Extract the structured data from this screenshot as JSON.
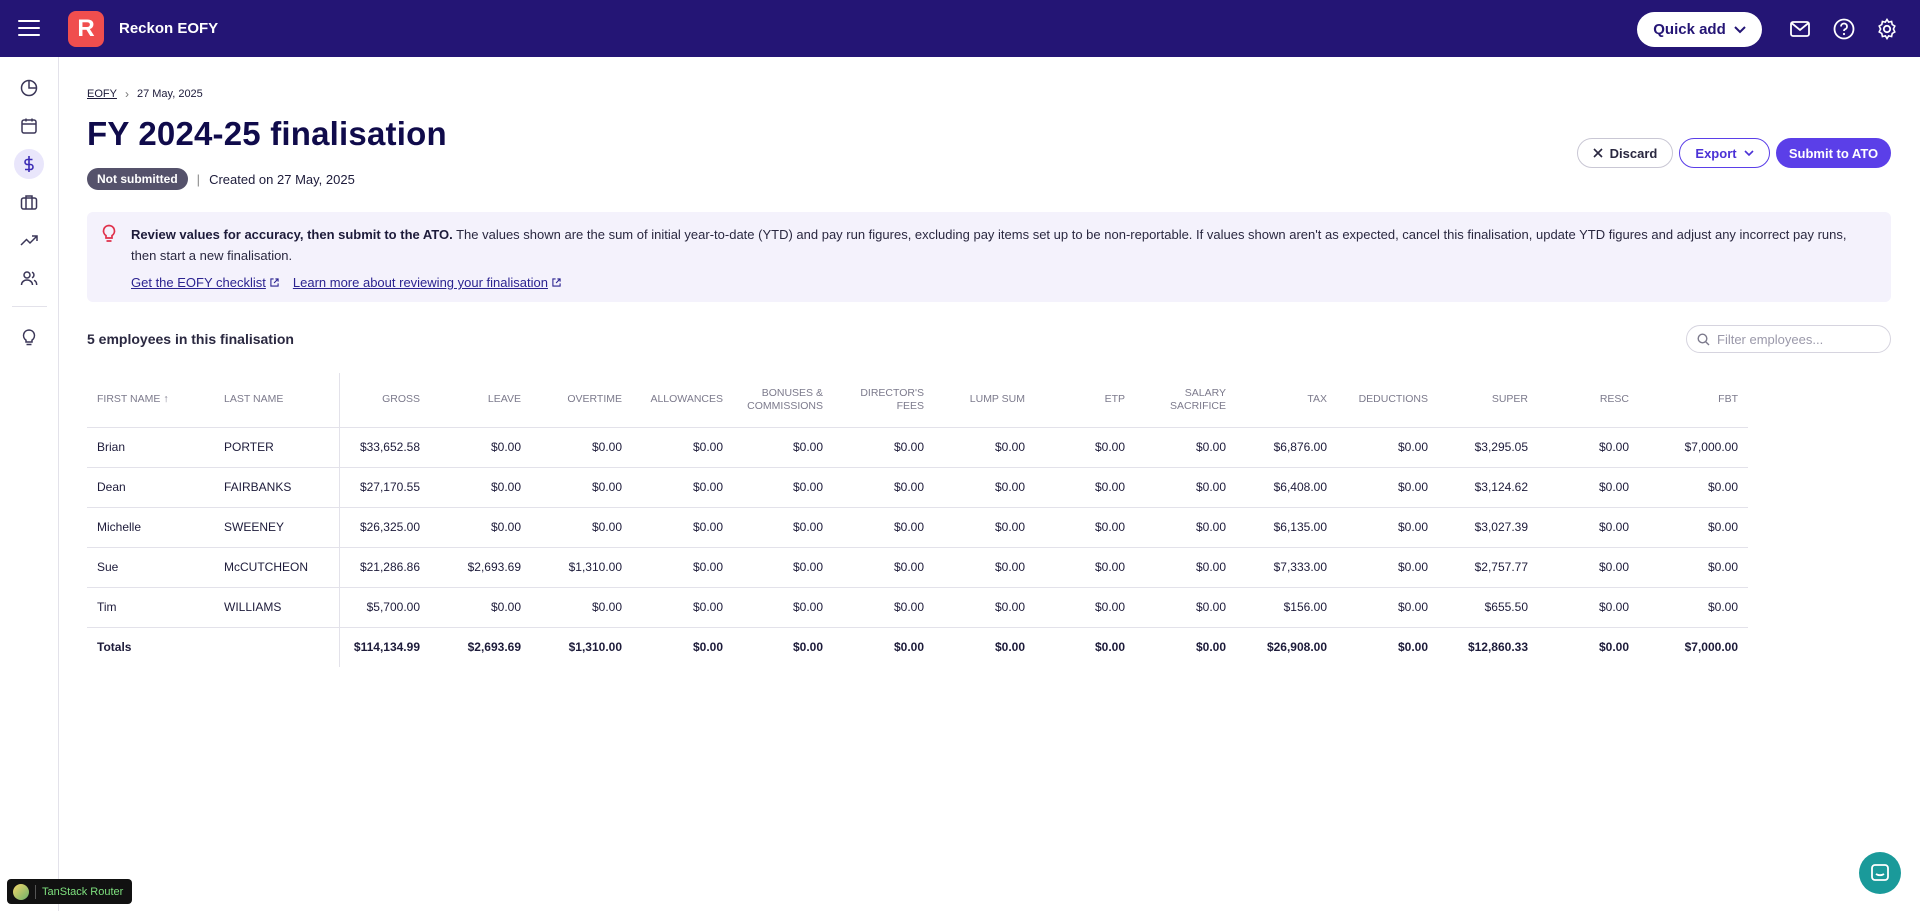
{
  "app": {
    "logo_letter": "R",
    "name": "Reckon EOFY"
  },
  "topbar": {
    "quick_add_label": "Quick add",
    "icons": [
      "mail-icon",
      "help-icon",
      "settings-icon"
    ]
  },
  "sidebar": {
    "icons": [
      "dashboard-icon",
      "calendar-icon",
      "dollar-icon",
      "briefcase-icon",
      "trend-icon",
      "people-icon",
      "lightbulb-icon"
    ],
    "active": "dollar-icon"
  },
  "breadcrumb": {
    "parent": "EOFY",
    "current": "27 May, 2025"
  },
  "page": {
    "title": "FY 2024-25 finalisation",
    "status_badge": "Not submitted",
    "status_separator": "|",
    "created": "Created on 27 May, 2025"
  },
  "actions": {
    "discard_label": "Discard",
    "export_label": "Export",
    "submit_label": "Submit to ATO"
  },
  "info": {
    "bold": "Review values for accuracy, then submit to the ATO.",
    "text": " The values shown are the sum of initial year-to-date (YTD) and pay run figures, excluding pay items set up to be non-reportable. If values shown aren't as expected, cancel this finalisation, update YTD figures and adjust any incorrect pay runs, then start a new finalisation.",
    "link1": "Get the EOFY checklist",
    "link2": "Learn more about reviewing your finalisation"
  },
  "employees_count_label": "5 employees in this finalisation",
  "filter": {
    "placeholder": "Filter employees..."
  },
  "table": {
    "headers": [
      "First name",
      "Last name",
      "Gross",
      "Leave",
      "Overtime",
      "Allowances",
      "Bonuses & Commissions",
      "Director's Fees",
      "Lump sum",
      "ETP",
      "Salary Sacrifice",
      "Tax",
      "Deductions",
      "Super",
      "RESC",
      "FBT"
    ],
    "rows": [
      [
        "Brian",
        "PORTER",
        "$33,652.58",
        "$0.00",
        "$0.00",
        "$0.00",
        "$0.00",
        "$0.00",
        "$0.00",
        "$0.00",
        "$0.00",
        "$6,876.00",
        "$0.00",
        "$3,295.05",
        "$0.00",
        "$7,000.00"
      ],
      [
        "Dean",
        "FAIRBANKS",
        "$27,170.55",
        "$0.00",
        "$0.00",
        "$0.00",
        "$0.00",
        "$0.00",
        "$0.00",
        "$0.00",
        "$0.00",
        "$6,408.00",
        "$0.00",
        "$3,124.62",
        "$0.00",
        "$0.00"
      ],
      [
        "Michelle",
        "SWEENEY",
        "$26,325.00",
        "$0.00",
        "$0.00",
        "$0.00",
        "$0.00",
        "$0.00",
        "$0.00",
        "$0.00",
        "$0.00",
        "$6,135.00",
        "$0.00",
        "$3,027.39",
        "$0.00",
        "$0.00"
      ],
      [
        "Sue",
        "McCUTCHEON",
        "$21,286.86",
        "$2,693.69",
        "$1,310.00",
        "$0.00",
        "$0.00",
        "$0.00",
        "$0.00",
        "$0.00",
        "$0.00",
        "$7,333.00",
        "$0.00",
        "$2,757.77",
        "$0.00",
        "$0.00"
      ],
      [
        "Tim",
        "WILLIAMS",
        "$5,700.00",
        "$0.00",
        "$0.00",
        "$0.00",
        "$0.00",
        "$0.00",
        "$0.00",
        "$0.00",
        "$0.00",
        "$156.00",
        "$0.00",
        "$655.50",
        "$0.00",
        "$0.00"
      ]
    ],
    "totals": [
      "Totals",
      "",
      "$114,134.99",
      "$2,693.69",
      "$1,310.00",
      "$0.00",
      "$0.00",
      "$0.00",
      "$0.00",
      "$0.00",
      "$0.00",
      "$26,908.00",
      "$0.00",
      "$12,860.33",
      "$0.00",
      "$7,000.00"
    ]
  },
  "devtools": {
    "label": "TanStack Router"
  }
}
